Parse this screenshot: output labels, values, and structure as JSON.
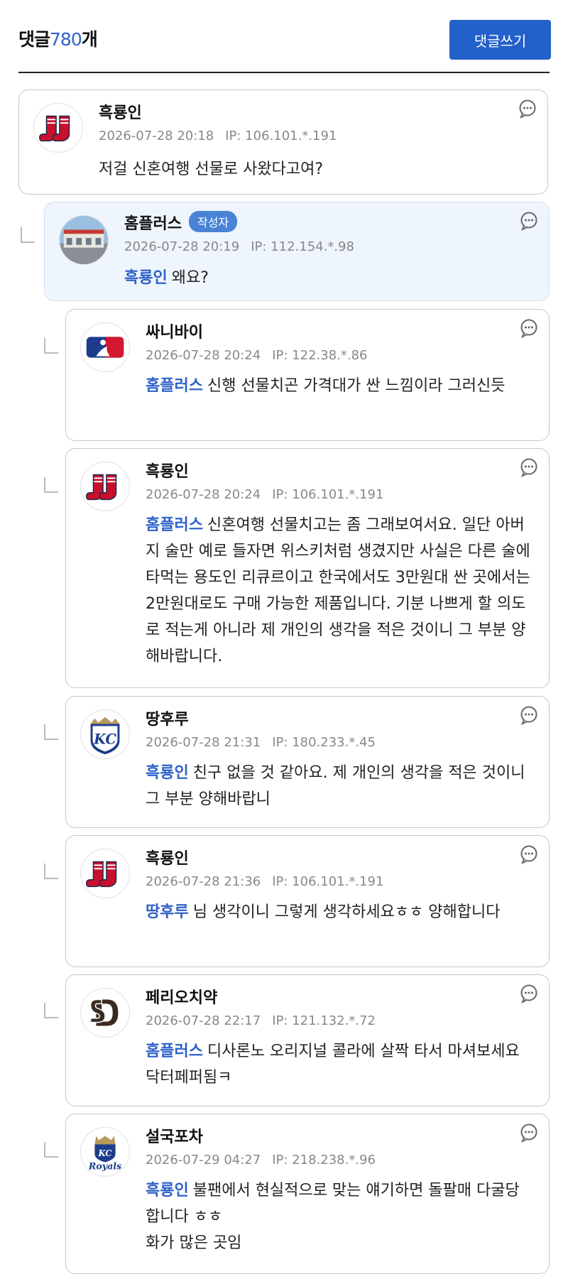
{
  "header": {
    "title_prefix": "댓글",
    "count": "780",
    "title_suffix": "개",
    "write_button": "댓글쓰기"
  },
  "ip_label": "IP:",
  "comments": [
    {
      "nick": "흑룡인",
      "date": "2026-07-28 20:18",
      "ip": "106.101.*.191",
      "mention": "",
      "text": "저걸 신혼여행 선물로 사왔다고여?",
      "logo": "red-sox-logo"
    },
    {
      "nick": "홈플러스",
      "badge": "작성자",
      "date": "2026-07-28 20:19",
      "ip": "112.154.*.98",
      "mention": "흑룡인",
      "text": "왜요?",
      "logo": "store-photo"
    },
    {
      "nick": "싸니바이",
      "date": "2026-07-28 20:24",
      "ip": "122.38.*.86",
      "mention": "홈플러스",
      "text": "신행 선물치곤 가격대가 싼 느낌이라 그러신듯",
      "logo": "mlb-logo"
    },
    {
      "nick": "흑룡인",
      "date": "2026-07-28 20:24",
      "ip": "106.101.*.191",
      "mention": "홈플러스",
      "text": "신혼여행 선물치고는 좀 그래보여서요. 일단 아버지 술만 예로 들자면 위스키처럼 생겼지만 사실은 다른 술에 타먹는 용도인 리큐르이고 한국에서도 3만원대 싼 곳에서는 2만원대로도 구매 가능한 제품입니다. 기분 나쁘게 할 의도로 적는게 아니라 제 개인의 생각을 적은 것이니 그 부분 양해바랍니다.",
      "logo": "red-sox-logo"
    },
    {
      "nick": "땅후루",
      "date": "2026-07-28 21:31",
      "ip": "180.233.*.45",
      "mention": "흑룡인",
      "text": "친구 없을 것 같아요. 제 개인의 생각을 적은 것이니 그 부분 양해바랍니",
      "logo": "royals-kc-logo"
    },
    {
      "nick": "흑룡인",
      "date": "2026-07-28 21:36",
      "ip": "106.101.*.191",
      "mention": "땅후루",
      "text": "님 생각이니 그렇게 생각하세요ㅎㅎ 양해합니다",
      "logo": "red-sox-logo"
    },
    {
      "nick": "페리오치약",
      "date": "2026-07-28 22:17",
      "ip": "121.132.*.72",
      "mention": "홈플러스",
      "text": "디사론노 오리지널 콜라에 살짝 타서 마셔보세요 닥터페퍼됨ㅋ",
      "logo": "padres-logo"
    },
    {
      "nick": "설국포차",
      "date": "2026-07-29 04:27",
      "ip": "218.238.*.96",
      "mention": "흑룡인",
      "text": "불팬에서 현실적으로 맞는 얘기하면 돌팔매 다굴당합니다 ㅎㅎ",
      "text2": "화가 많은 곳임",
      "logo": "royals-logo"
    }
  ]
}
